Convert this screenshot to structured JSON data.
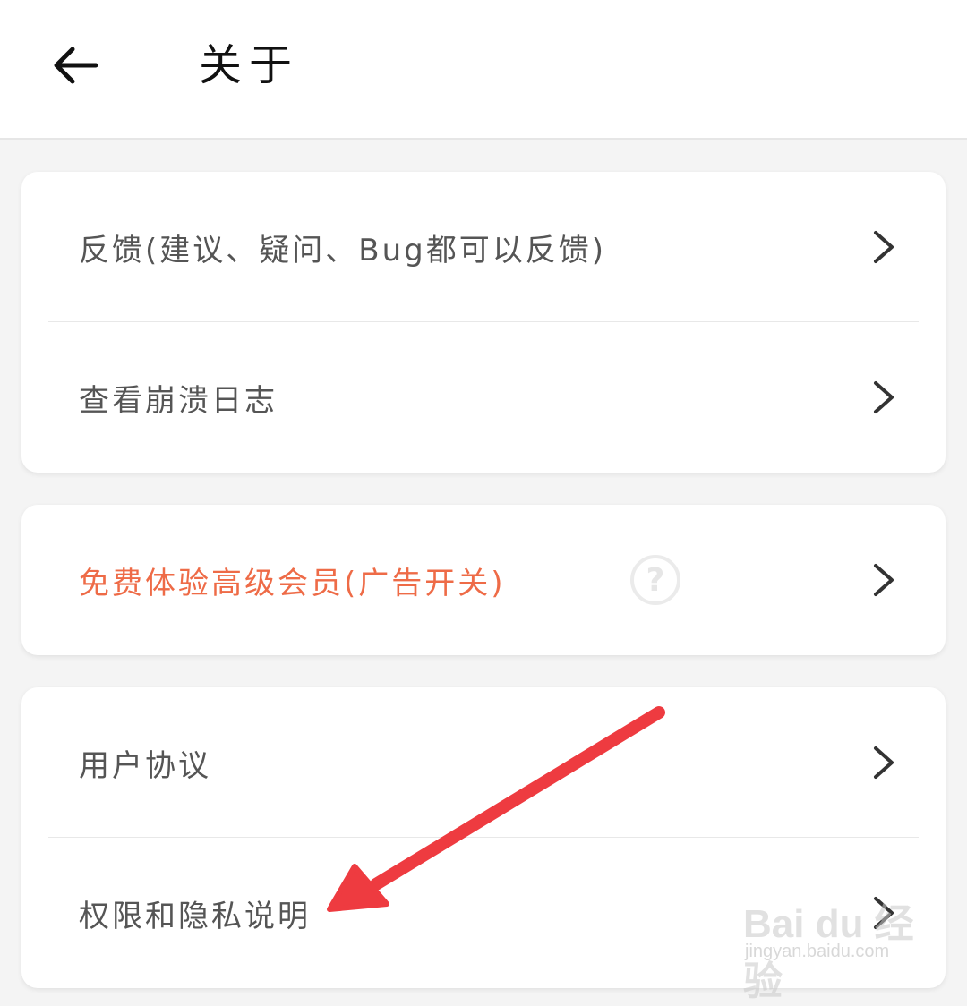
{
  "header": {
    "title": "关于",
    "back_icon": "arrow-left-icon"
  },
  "cards": [
    {
      "items": [
        {
          "label": "反馈(建议、疑问、Bug都可以反馈)"
        },
        {
          "label": "查看崩溃日志"
        }
      ]
    },
    {
      "items": [
        {
          "label": "免费体验高级会员(广告开关)",
          "help_glyph": "?"
        }
      ]
    },
    {
      "items": [
        {
          "label": "用户协议"
        },
        {
          "label": "权限和隐私说明"
        }
      ]
    }
  ],
  "watermark": {
    "logo": "Bai du 经验",
    "url": "jingyan.baidu.com"
  },
  "colors": {
    "accent": "#ee6b47",
    "annotation_arrow": "#ee3b40"
  }
}
